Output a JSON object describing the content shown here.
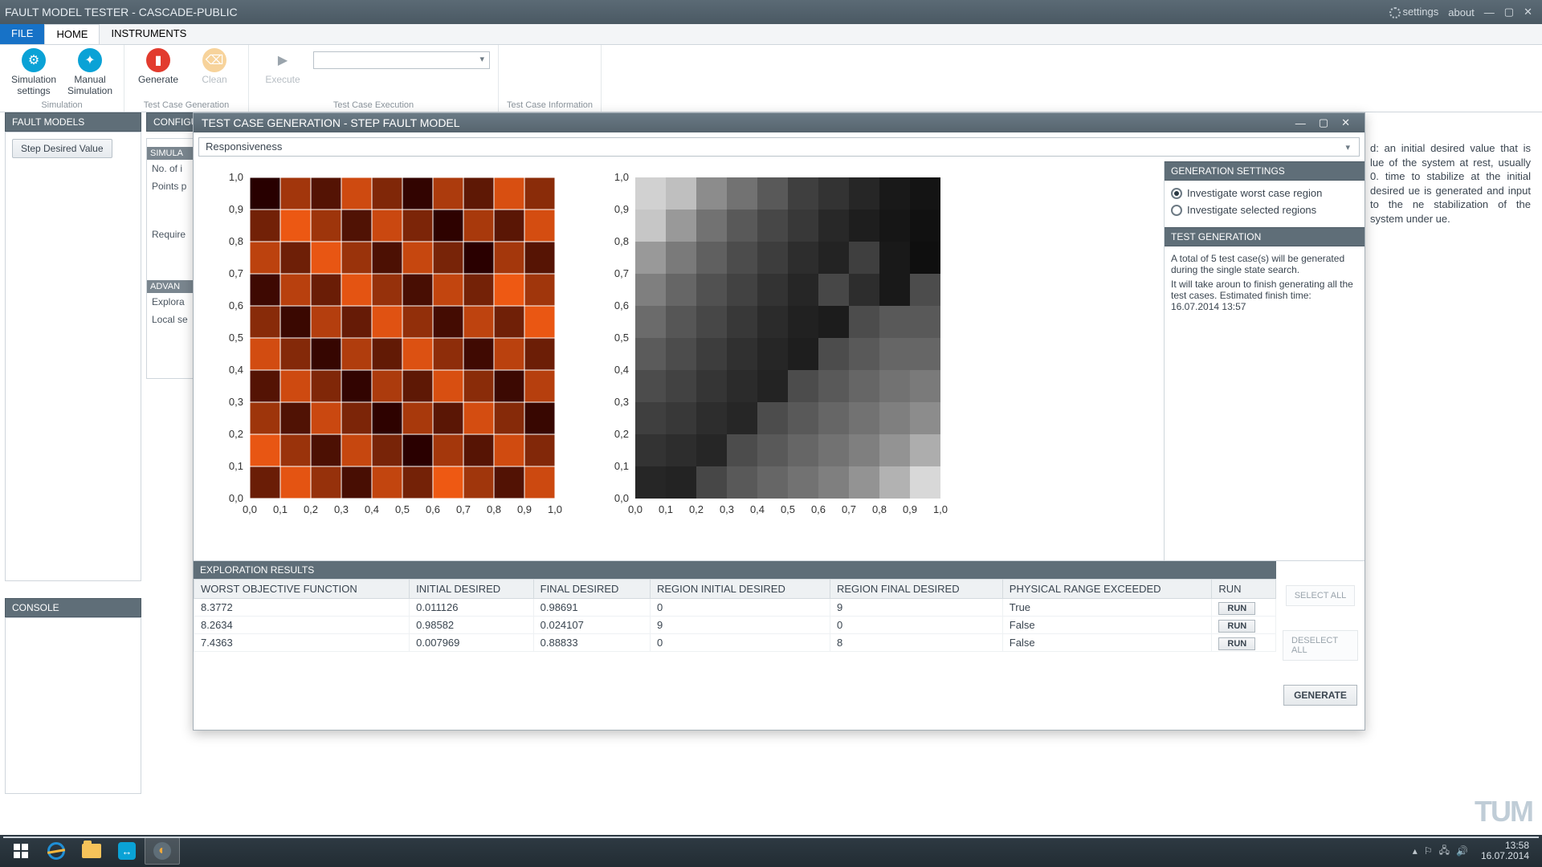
{
  "titlebar": {
    "title": "FAULT MODEL TESTER - CASCADE-PUBLIC",
    "settings": "settings",
    "about": "about"
  },
  "menu": {
    "file": "FILE",
    "home": "HOME",
    "instruments": "INSTRUMENTS"
  },
  "ribbon": {
    "simsettings": "Simulation\nsettings",
    "manualsim": "Manual\nSimulation",
    "generate": "Generate",
    "clean": "Clean",
    "execute": "Execute",
    "g_sim": "Simulation",
    "g_gen": "Test Case Generation",
    "g_exec": "Test Case Execution",
    "g_info": "Test Case Information"
  },
  "left": {
    "fault_models": "FAULT MODELS",
    "step_desired": "Step Desired Value",
    "config": "CONFIGU",
    "simu": "SIMULA",
    "noof": "No. of i",
    "points": "Points p",
    "require": "Require",
    "advan": "ADVAN",
    "explora": "Explora",
    "localse": "Local se",
    "console": "CONSOLE"
  },
  "modal": {
    "title": "TEST CASE GENERATION - STEP FAULT MODEL",
    "select_value": "Responsiveness",
    "gen_settings": "GENERATION SETTINGS",
    "opt_worst": "Investigate worst case region",
    "opt_selected": "Investigate selected regions",
    "test_generation": "TEST GENERATION",
    "tg_text1": "A total of 5 test case(s) will be generated during the single state search.",
    "tg_text2": "It will take aroun to finish generating all the test cases. Estimated finish time: 16.07.2014 13:57",
    "explore_hdr": "EXPLORATION RESULTS",
    "cols": {
      "wof": "WORST OBJECTIVE FUNCTION",
      "initd": "INITIAL DESIRED",
      "finald": "FINAL DESIRED",
      "regi": "REGION INITIAL DESIRED",
      "regf": "REGION FINAL DESIRED",
      "phys": "PHYSICAL RANGE EXCEEDED",
      "run": "RUN"
    },
    "rows": [
      {
        "wof": "8.3772",
        "initd": "0.011126",
        "finald": "0.98691",
        "regi": "0",
        "regf": "9",
        "phys": "True"
      },
      {
        "wof": "8.2634",
        "initd": "0.98582",
        "finald": "0.024107",
        "regi": "9",
        "regf": "0",
        "phys": "False"
      },
      {
        "wof": "7.4363",
        "initd": "0.007969",
        "finald": "0.88833",
        "regi": "0",
        "regf": "8",
        "phys": "False"
      }
    ],
    "run_label": "RUN",
    "select_all": "SELECT ALL",
    "deselect_all": "DESELECT ALL",
    "generate_btn": "GENERATE"
  },
  "rightclip": "d: an initial desired value that is lue of the system at rest, usually 0. time to stabilize at the initial desired ue is generated and input to the ne stabilization of the system under ue.",
  "logo": "TUM",
  "taskbar": {
    "time": "13:58",
    "date": "16.07.2014"
  },
  "chart_data": [
    {
      "type": "heatmap",
      "title": "",
      "xlabel": "",
      "ylabel": "",
      "xticks": [
        "0,0",
        "0,1",
        "0,2",
        "0,3",
        "0,4",
        "0,5",
        "0,6",
        "0,7",
        "0,8",
        "0,9",
        "1,0"
      ],
      "yticks": [
        "0,0",
        "0,1",
        "0,2",
        "0,3",
        "0,4",
        "0,5",
        "0,6",
        "0,7",
        "0,8",
        "0,9",
        "1,0"
      ],
      "xlim": [
        0,
        1
      ],
      "ylim": [
        0,
        1
      ],
      "note": "dense orange/black speckled noise pattern on 10x10 grid; no discrete per-cell scalar readable"
    },
    {
      "type": "heatmap",
      "title": "",
      "xlabel": "",
      "ylabel": "",
      "xticks": [
        "0,0",
        "0,1",
        "0,2",
        "0,3",
        "0,4",
        "0,5",
        "0,6",
        "0,7",
        "0,8",
        "0,9",
        "1,0"
      ],
      "yticks": [
        "0,0",
        "0,1",
        "0,2",
        "0,3",
        "0,4",
        "0,5",
        "0,6",
        "0,7",
        "0,8",
        "0,9",
        "1,0"
      ],
      "xlim": [
        0,
        1
      ],
      "ylim": [
        0,
        1
      ],
      "values_rows_top_to_bottom": [
        [
          0.82,
          0.75,
          0.55,
          0.45,
          0.35,
          0.25,
          0.2,
          0.15,
          0.1,
          0.08
        ],
        [
          0.78,
          0.6,
          0.45,
          0.35,
          0.28,
          0.22,
          0.16,
          0.12,
          0.09,
          0.07
        ],
        [
          0.6,
          0.48,
          0.38,
          0.3,
          0.24,
          0.18,
          0.14,
          0.25,
          0.1,
          0.06
        ],
        [
          0.5,
          0.4,
          0.32,
          0.26,
          0.2,
          0.15,
          0.28,
          0.18,
          0.1,
          0.3
        ],
        [
          0.42,
          0.34,
          0.28,
          0.22,
          0.17,
          0.13,
          0.11,
          0.3,
          0.35,
          0.35
        ],
        [
          0.36,
          0.3,
          0.24,
          0.19,
          0.15,
          0.12,
          0.3,
          0.35,
          0.4,
          0.4
        ],
        [
          0.3,
          0.26,
          0.21,
          0.17,
          0.14,
          0.3,
          0.35,
          0.4,
          0.45,
          0.48
        ],
        [
          0.25,
          0.22,
          0.18,
          0.15,
          0.3,
          0.35,
          0.4,
          0.45,
          0.5,
          0.55
        ],
        [
          0.2,
          0.18,
          0.15,
          0.3,
          0.35,
          0.4,
          0.45,
          0.5,
          0.58,
          0.68
        ],
        [
          0.15,
          0.14,
          0.28,
          0.35,
          0.4,
          0.45,
          0.5,
          0.58,
          0.7,
          0.85
        ]
      ],
      "note": "0 = black, 1 = white"
    }
  ]
}
